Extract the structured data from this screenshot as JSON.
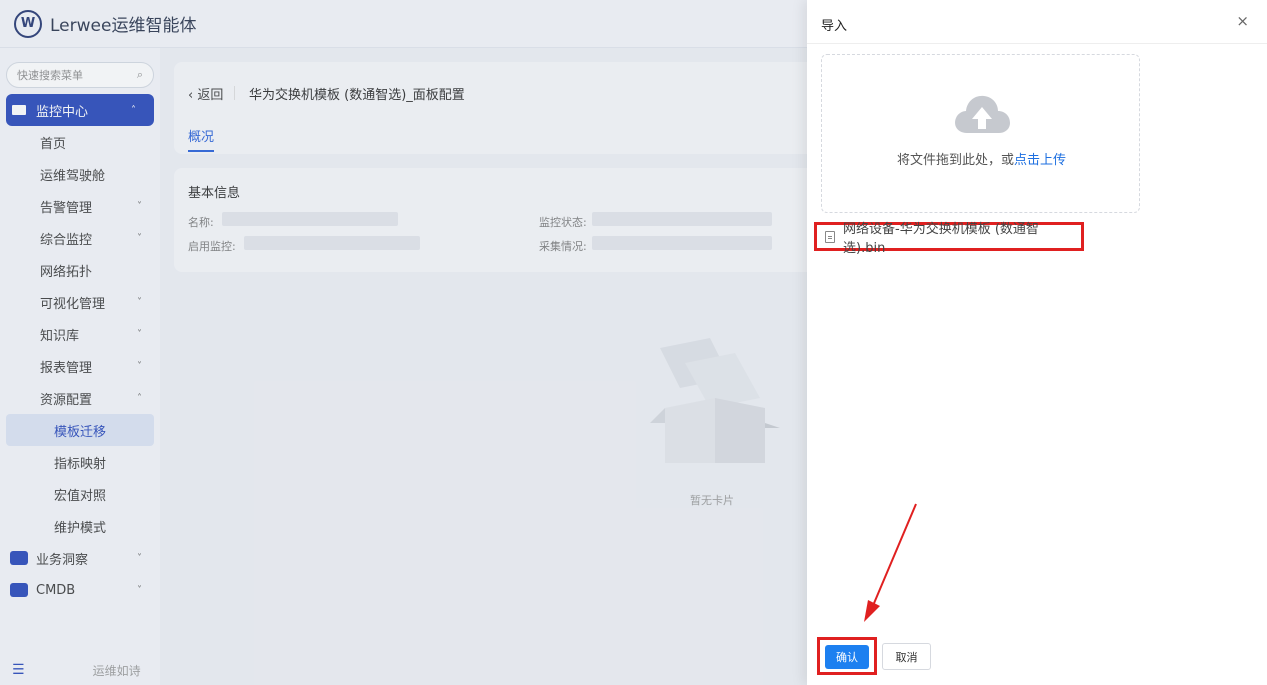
{
  "app": {
    "title": "Lerwee运维智能体",
    "logo_letter": "W"
  },
  "sidebar": {
    "search_placeholder": "快速搜索菜单",
    "items": [
      {
        "label": "监控中心",
        "level": "top",
        "state": "active-parent",
        "chevron": "˄",
        "icon_color": "#ffffff"
      },
      {
        "label": "首页",
        "level": "lvl1"
      },
      {
        "label": "运维驾驶舱",
        "level": "lvl1"
      },
      {
        "label": "告警管理",
        "level": "lvl1",
        "chevron": "˅"
      },
      {
        "label": "综合监控",
        "level": "lvl1",
        "chevron": "˅"
      },
      {
        "label": "网络拓扑",
        "level": "lvl1"
      },
      {
        "label": "可视化管理",
        "level": "lvl1",
        "chevron": "˅"
      },
      {
        "label": "知识库",
        "level": "lvl1",
        "chevron": "˅"
      },
      {
        "label": "报表管理",
        "level": "lvl1",
        "chevron": "˅"
      },
      {
        "label": "资源配置",
        "level": "lvl1",
        "chevron": "˄"
      },
      {
        "label": "模板迁移",
        "level": "lvl2",
        "state": "active-item"
      },
      {
        "label": "指标映射",
        "level": "lvl2"
      },
      {
        "label": "宏值对照",
        "level": "lvl2"
      },
      {
        "label": "维护模式",
        "level": "lvl2"
      },
      {
        "label": "业务洞察",
        "level": "top",
        "chevron": "˅",
        "icon_color": "#1d3fb8"
      },
      {
        "label": "CMDB",
        "level": "top",
        "chevron": "˅",
        "icon_color": "#1d3fb8"
      }
    ],
    "footer_text": "运维如诗"
  },
  "page": {
    "back_label": "返回",
    "title": "华为交换机模板 (数通智选)_面板配置",
    "tab": "概况",
    "section_title": "基本信息",
    "fields": {
      "name": "名称:",
      "enable": "启用监控:",
      "status": "监控状态:",
      "collect": "采集情况:"
    },
    "empty_text": "暂无卡片"
  },
  "drawer": {
    "title": "导入",
    "close": "×",
    "drop_text": "将文件拖到此处，或",
    "drop_link": "点击上传",
    "file_name": "网络设备-华为交换机模板 (数通智选).bin",
    "confirm": "确认",
    "cancel": "取消"
  },
  "colors": {
    "accent": "#1d80f0",
    "highlight": "#e02020",
    "nav_active": "#1d3fb8"
  }
}
